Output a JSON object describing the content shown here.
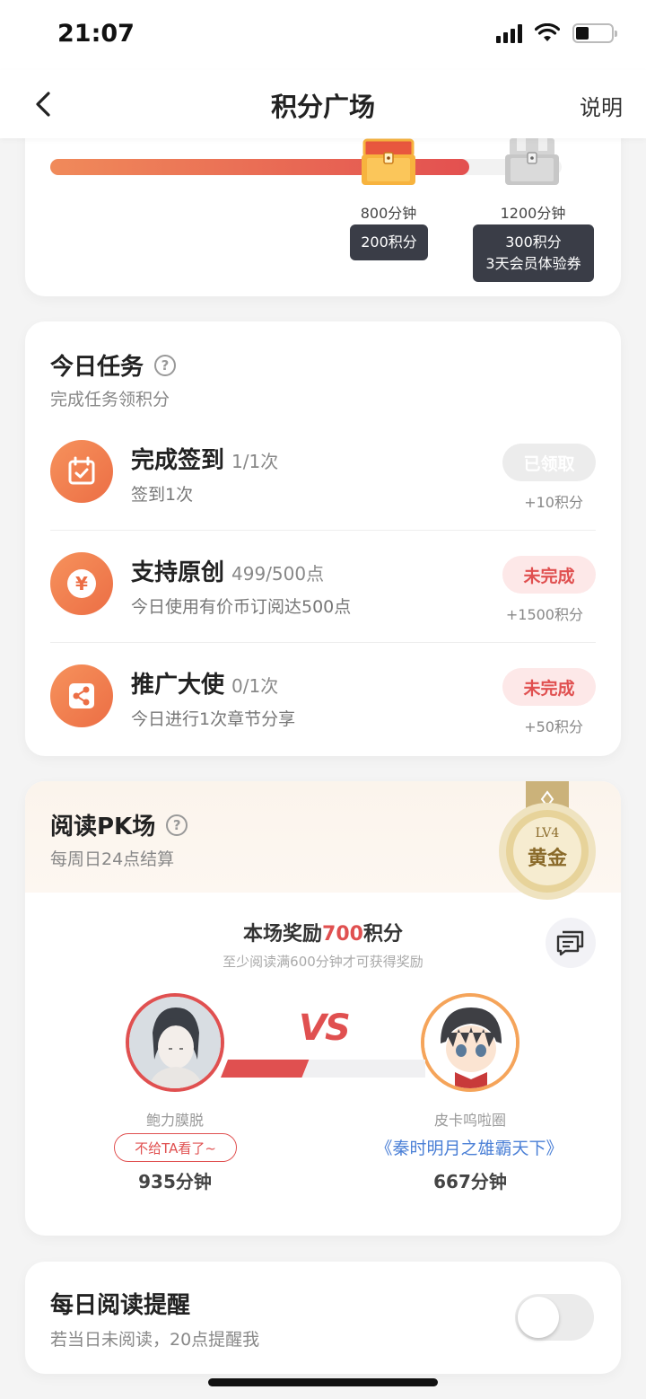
{
  "status": {
    "time": "21:07"
  },
  "nav": {
    "title": "积分广场",
    "help": "说明"
  },
  "progress": {
    "fraction": 0.82,
    "milestones": [
      {
        "label": "800分钟",
        "reward": "200积分",
        "reached": true
      },
      {
        "label": "1200分钟",
        "reward_line1": "300积分",
        "reward_line2": "3天会员体验券",
        "reached": false
      }
    ]
  },
  "tasks": {
    "title": "今日任务",
    "help_icon": "?",
    "subtitle": "完成任务领积分",
    "items": [
      {
        "icon": "calendar-check-icon",
        "name": "完成签到",
        "progress": "1/1次",
        "desc": "签到1次",
        "status": "已领取",
        "points": "+10积分",
        "done": true
      },
      {
        "icon": "yen-coin-icon",
        "name": "支持原创",
        "progress": "499/500点",
        "desc": "今日使用有价币订阅达500点",
        "status": "未完成",
        "points": "+1500积分",
        "done": false
      },
      {
        "icon": "share-icon",
        "name": "推广大使",
        "progress": "0/1次",
        "desc": "今日进行1次章节分享",
        "status": "未完成",
        "points": "+50积分",
        "done": false
      }
    ]
  },
  "pk": {
    "title": "阅读PK场",
    "help_icon": "?",
    "subtitle": "每周日24点结算",
    "medal": {
      "level": "LV4",
      "rank": "黄金"
    },
    "reward_prefix": "本场奖励",
    "reward_value": "700",
    "reward_suffix": "积分",
    "reward_note": "至少阅读满600分钟才可获得奖励",
    "vs": "VS",
    "left": {
      "name": "鲍力膜脱",
      "tag": "不给TA看了~",
      "minutes": "935分钟",
      "value": 935
    },
    "right": {
      "name": "皮卡呜啦圈",
      "book": "《秦时明月之雄霸天下》",
      "minutes": "667分钟",
      "value": 667
    }
  },
  "reminder": {
    "title": "每日阅读提醒",
    "desc": "若当日未阅读，20点提醒我",
    "enabled": false
  },
  "colors": {
    "accent": "#e05050",
    "orange": "#f08a5a",
    "link": "#4a7fd6"
  }
}
